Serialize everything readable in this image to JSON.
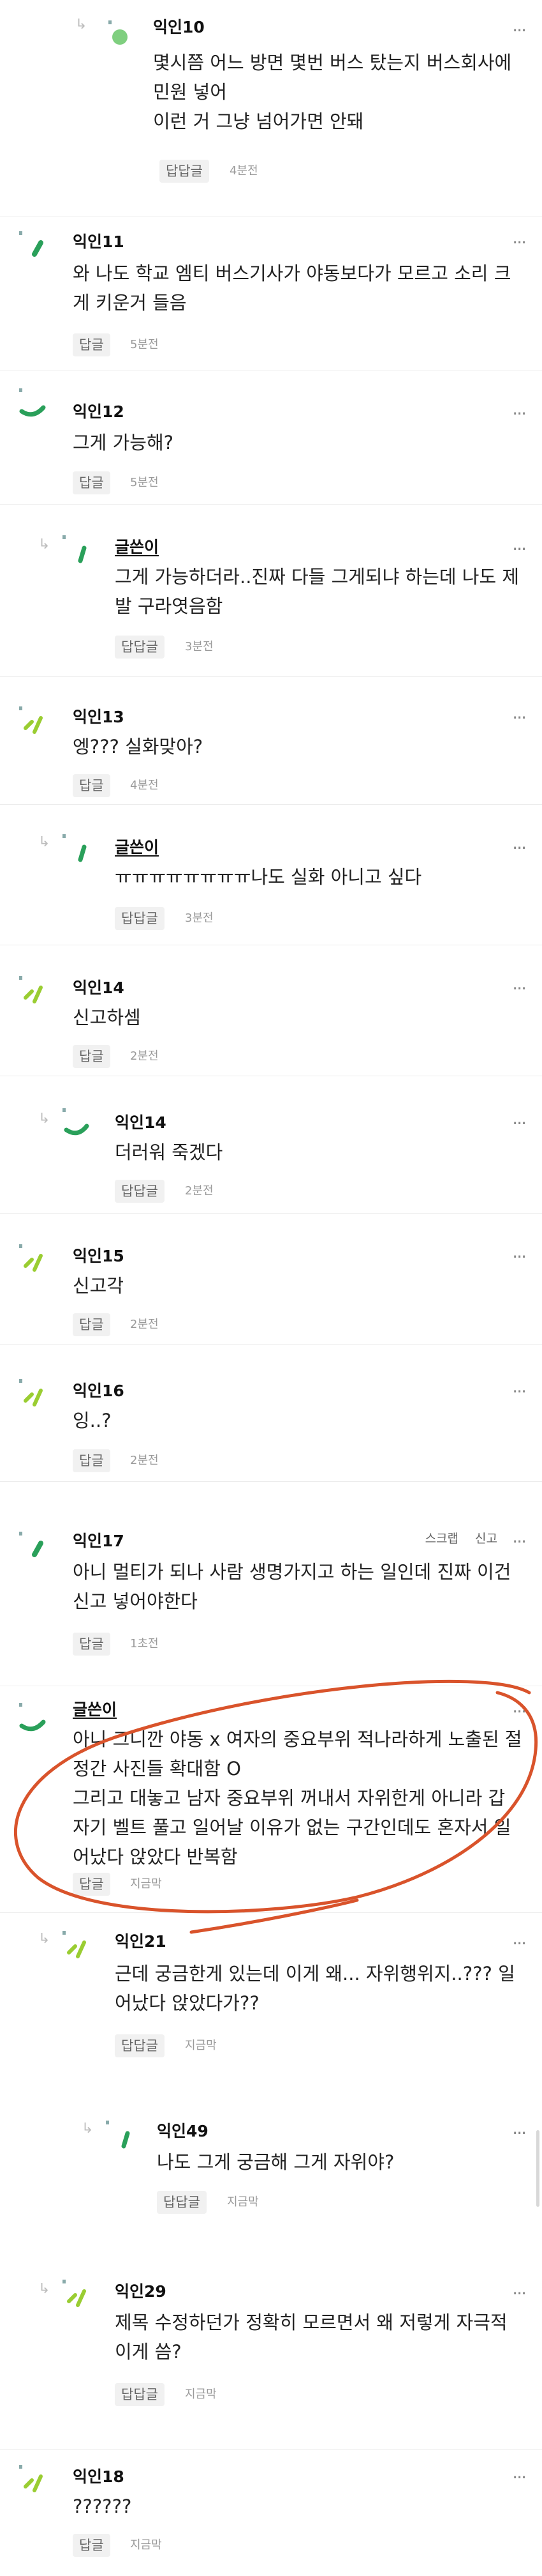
{
  "reply_label": "답글",
  "reply_label_nested": "답답글",
  "more_label": "···",
  "actions": {
    "scrap": "스크랩",
    "report": "신고"
  },
  "comments": [
    {
      "author": "익인10",
      "text": "몇시쯤 어느 방면 몇번 버스 탔는지 버스회사에\n민원 넣어\n이런 거 그냥 넘어가면 안돼",
      "reply": "답답글",
      "time": "4분전"
    },
    {
      "author": "익인11",
      "text": "와 나도 학교 엠티 버스기사가 야동보다가 모르고 소리 크\n게 키운거 들음",
      "reply": "답글",
      "time": "5분전"
    },
    {
      "author": "익인12",
      "text": "그게 가능해?",
      "reply": "답글",
      "time": "5분전"
    },
    {
      "author": "글쓴이",
      "text": "그게 가능하더라..진짜 다들 그게되냐 하는데 나도 제\n발 구라엿음함",
      "reply": "답답글",
      "time": "3분전"
    },
    {
      "author": "익인13",
      "text": "엥??? 실화맞아?",
      "reply": "답글",
      "time": "4분전"
    },
    {
      "author": "글쓴이",
      "text": "ㅠㅠㅠㅠㅠㅠㅠㅠ나도 실화 아니고 싶다",
      "reply": "답답글",
      "time": "3분전"
    },
    {
      "author": "익인14",
      "text": "신고하셈",
      "reply": "답글",
      "time": "2분전"
    },
    {
      "author": "익인14",
      "text": "더러워 죽겠다",
      "reply": "답답글",
      "time": "2분전"
    },
    {
      "author": "익인15",
      "text": "신고각",
      "reply": "답글",
      "time": "2분전"
    },
    {
      "author": "익인16",
      "text": "잉..?",
      "reply": "답글",
      "time": "2분전"
    },
    {
      "author": "익인17",
      "text": "아니 멀티가 되나 사람 생명가지고 하는 일인데 진짜 이건\n신고 넣어야한다",
      "reply": "답글",
      "time": "1초전"
    },
    {
      "author": "글쓴이",
      "text": "아니 그니깐 야동 x 여자의 중요부위 적나라하게 노출된 절\n정간 사진들 확대함 O\n그리고 대놓고 남자 중요부위 꺼내서 자위한게 아니라 갑\n자기 벨트 풀고 일어날 이유가 없는 구간인데도 혼자서 일\n어났다 앉았다 반복함",
      "reply": "답글",
      "time": "지금막"
    },
    {
      "author": "익인21",
      "text": "근데 궁금한게 있는데 이게 왜... 자위행위지..??? 일\n어났다 앉았다가??",
      "reply": "답답글",
      "time": "지금막"
    },
    {
      "author": "익인49",
      "text": "나도 그게 궁금해 그게 자위야?",
      "reply": "답답글",
      "time": "지금막"
    },
    {
      "author": "익인29",
      "text": "제목 수정하던가 정확히 모르면서 왜 저렇게 자극적\n이게 씀?",
      "reply": "답답글",
      "time": "지금막"
    },
    {
      "author": "익인18",
      "text": "??????",
      "reply": "답글",
      "time": "지금막"
    }
  ],
  "colors": {
    "avatar_dark_green": "#2aa05a",
    "avatar_light_green": "#9acd32",
    "annotation_red": "#d9532b"
  }
}
